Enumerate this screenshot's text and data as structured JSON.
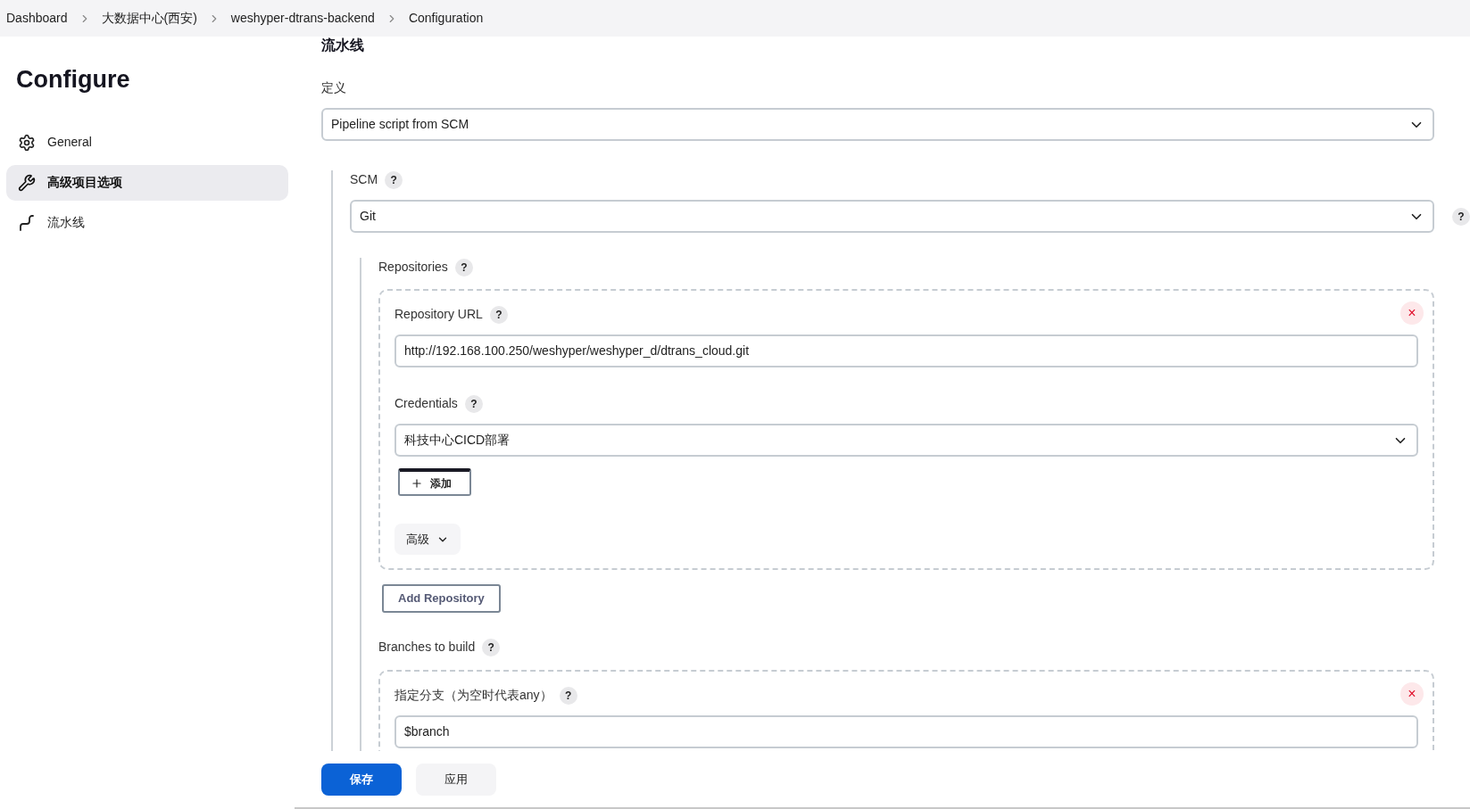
{
  "breadcrumbs": [
    "Dashboard",
    "大数据中心(西安)",
    "weshyper-dtrans-backend",
    "Configuration"
  ],
  "sidebar": {
    "title": "Configure",
    "items": [
      {
        "label": "General",
        "kind": "general",
        "selected": false
      },
      {
        "label": "高级项目选项",
        "kind": "advanced",
        "selected": true
      },
      {
        "label": "流水线",
        "kind": "pipeline",
        "selected": false
      }
    ]
  },
  "section": {
    "title": "流水线",
    "definition": {
      "label": "定义",
      "value": "Pipeline script from SCM"
    },
    "scm": {
      "label": "SCM",
      "help": "?",
      "value": "Git",
      "side_help": "?",
      "repositories": {
        "label": "Repositories",
        "help": "?",
        "items": [
          {
            "url_label": "Repository URL",
            "url_help": "?",
            "url": "http://192.168.100.250/weshyper/weshyper_d/dtrans_cloud.git",
            "credentials_label": "Credentials",
            "credentials_help": "?",
            "credentials": "科技中心CICD部署",
            "add_button": "添加",
            "advanced_button": "高级",
            "remove": "×"
          }
        ],
        "add_button": "Add Repository"
      },
      "branches": {
        "label": "Branches to build",
        "help": "?",
        "items": [
          {
            "label": "指定分支（为空时代表any）",
            "help": "?",
            "value": "$branch",
            "remove": "×"
          }
        ]
      }
    }
  },
  "footer": {
    "buttons": [
      {
        "label": "保存",
        "kind": "primary"
      },
      {
        "label": "应用",
        "kind": "secondary"
      }
    ]
  }
}
